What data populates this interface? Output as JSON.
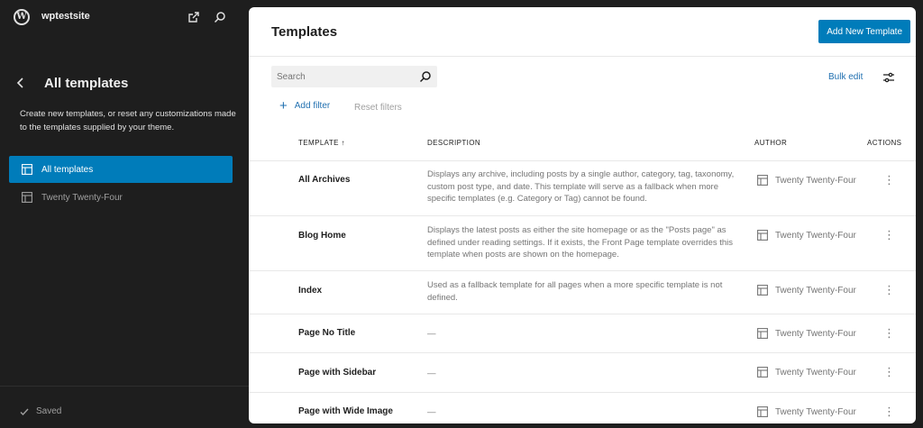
{
  "site": {
    "name": "wptestsite"
  },
  "sidebar": {
    "title": "All templates",
    "description": "Create new templates, or reset any customizations made to the templates supplied by your theme.",
    "items": [
      {
        "label": "All templates",
        "active": true,
        "icon": "layout-icon"
      },
      {
        "label": "Twenty Twenty-Four",
        "active": false,
        "icon": "layout-icon"
      }
    ],
    "footer_status": "Saved"
  },
  "main": {
    "title": "Templates",
    "add_button": "Add New Template",
    "search_placeholder": "Search",
    "bulk_edit": "Bulk edit",
    "add_filter": "Add filter",
    "reset_filters": "Reset filters",
    "columns": {
      "template": "TEMPLATE ↑",
      "description": "DESCRIPTION",
      "author": "AUTHOR",
      "actions": "ACTIONS"
    },
    "rows": [
      {
        "name": "All Archives",
        "description": "Displays any archive, including posts by a single author, category, tag, taxonomy, custom post type, and date. This template will serve as a fallback when more specific templates (e.g. Category or Tag) cannot be found.",
        "author": "Twenty Twenty-Four"
      },
      {
        "name": "Blog Home",
        "description": "Displays the latest posts as either the site homepage or as the \"Posts page\" as defined under reading settings. If it exists, the Front Page template overrides this template when posts are shown on the homepage.",
        "author": "Twenty Twenty-Four"
      },
      {
        "name": "Index",
        "description": "Used as a fallback template for all pages when a more specific template is not defined.",
        "author": "Twenty Twenty-Four"
      },
      {
        "name": "Page No Title",
        "description": "—",
        "author": "Twenty Twenty-Four"
      },
      {
        "name": "Page with Sidebar",
        "description": "—",
        "author": "Twenty Twenty-Four"
      },
      {
        "name": "Page with Wide Image",
        "description": "—",
        "author": "Twenty Twenty-Four"
      }
    ]
  },
  "colors": {
    "accent": "#007cba",
    "sidebar_bg": "#1e1e1e",
    "link": "#2271b1"
  }
}
